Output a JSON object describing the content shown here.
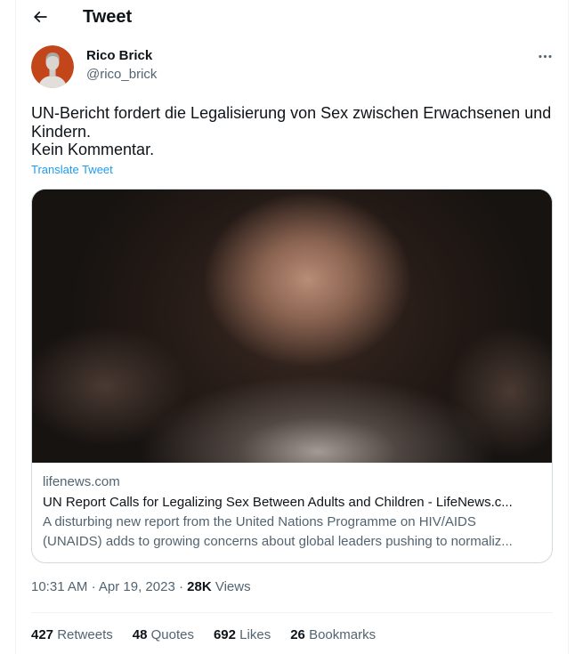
{
  "header": {
    "title": "Tweet"
  },
  "icons": {
    "back": "arrow-left-icon",
    "more": "more-horizontal-icon"
  },
  "tweet": {
    "author": {
      "name": "Rico Brick",
      "handle": "@rico_brick"
    },
    "text": "UN-Bericht fordert die Legalisierung von Sex zwischen Erwachsenen und Kindern.\nKein Kommentar.",
    "translate_label": "Translate Tweet",
    "link_card": {
      "domain": "lifenews.com",
      "title": "UN Report Calls for Legalizing Sex Between Adults and Children - LifeNews.c...",
      "description_lines": [
        "A disturbing new report from the United Nations Programme on HIV/AIDS",
        "(UNAIDS) adds to growing concerns about global leaders pushing to normaliz..."
      ]
    },
    "meta": {
      "time": "10:31 AM",
      "separator": "·",
      "date": "Apr 19, 2023",
      "views_count": "28K",
      "views_label": "Views"
    },
    "stats": [
      {
        "count": "427",
        "label": "Retweets"
      },
      {
        "count": "48",
        "label": "Quotes"
      },
      {
        "count": "692",
        "label": "Likes"
      },
      {
        "count": "26",
        "label": "Bookmarks"
      }
    ]
  },
  "colors": {
    "text": "#0f1419",
    "secondary": "#536471",
    "link": "#1d9bf0",
    "card_border": "#cfd9de",
    "divider": "#eff3f4",
    "avatar_background": "#c2461a"
  }
}
